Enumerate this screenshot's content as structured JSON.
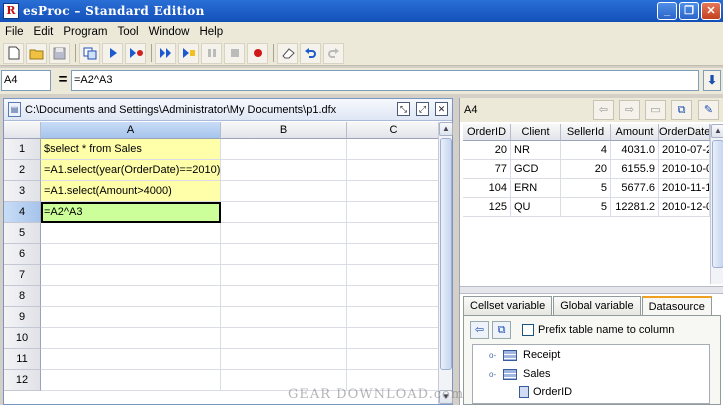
{
  "window": {
    "title": "esProc – Standard Edition",
    "app_icon_glyph": "R"
  },
  "menu": {
    "items": [
      "File",
      "Edit",
      "Program",
      "Tool",
      "Window",
      "Help"
    ]
  },
  "formula": {
    "cell_name": "A4",
    "equals": "=",
    "value": "=A2^A3"
  },
  "sheet": {
    "path": "C:\\Documents and Settings\\Administrator\\My Documents\\p1.dfx",
    "columns": [
      "A",
      "B",
      "C"
    ],
    "rows": [
      "1",
      "2",
      "3",
      "4",
      "5",
      "6",
      "7",
      "8",
      "9",
      "10",
      "11",
      "12"
    ],
    "cells": [
      "$select * from Sales",
      "=A1.select(year(OrderDate)==2010)",
      "=A1.select(Amount>4000)",
      "=A2^A3"
    ]
  },
  "result": {
    "cell_name": "A4",
    "headers": [
      "OrderID",
      "Client",
      "SellerId",
      "Amount",
      "OrderDate"
    ],
    "rows": [
      [
        "20",
        "NR",
        "4",
        "4031.0",
        "2010-07-2"
      ],
      [
        "77",
        "GCD",
        "20",
        "6155.9",
        "2010-10-0"
      ],
      [
        "104",
        "ERN",
        "5",
        "5677.6",
        "2010-11-1"
      ],
      [
        "125",
        "QU",
        "5",
        "12281.2",
        "2010-12-0"
      ]
    ]
  },
  "tabs": [
    "Cellset variable",
    "Global variable",
    "Datasource"
  ],
  "datasource": {
    "prefix_label": "Prefix table name to column",
    "tree": [
      "Receipt",
      "Sales",
      "OrderID"
    ]
  },
  "watermark": "GEAR DOWNLOAD.com",
  "colors": {
    "cell_yellow": "#ffffaa",
    "cell_green": "#ccff99",
    "titlebar": "#1f5fcf",
    "tab_highlight": "#f0a020"
  }
}
